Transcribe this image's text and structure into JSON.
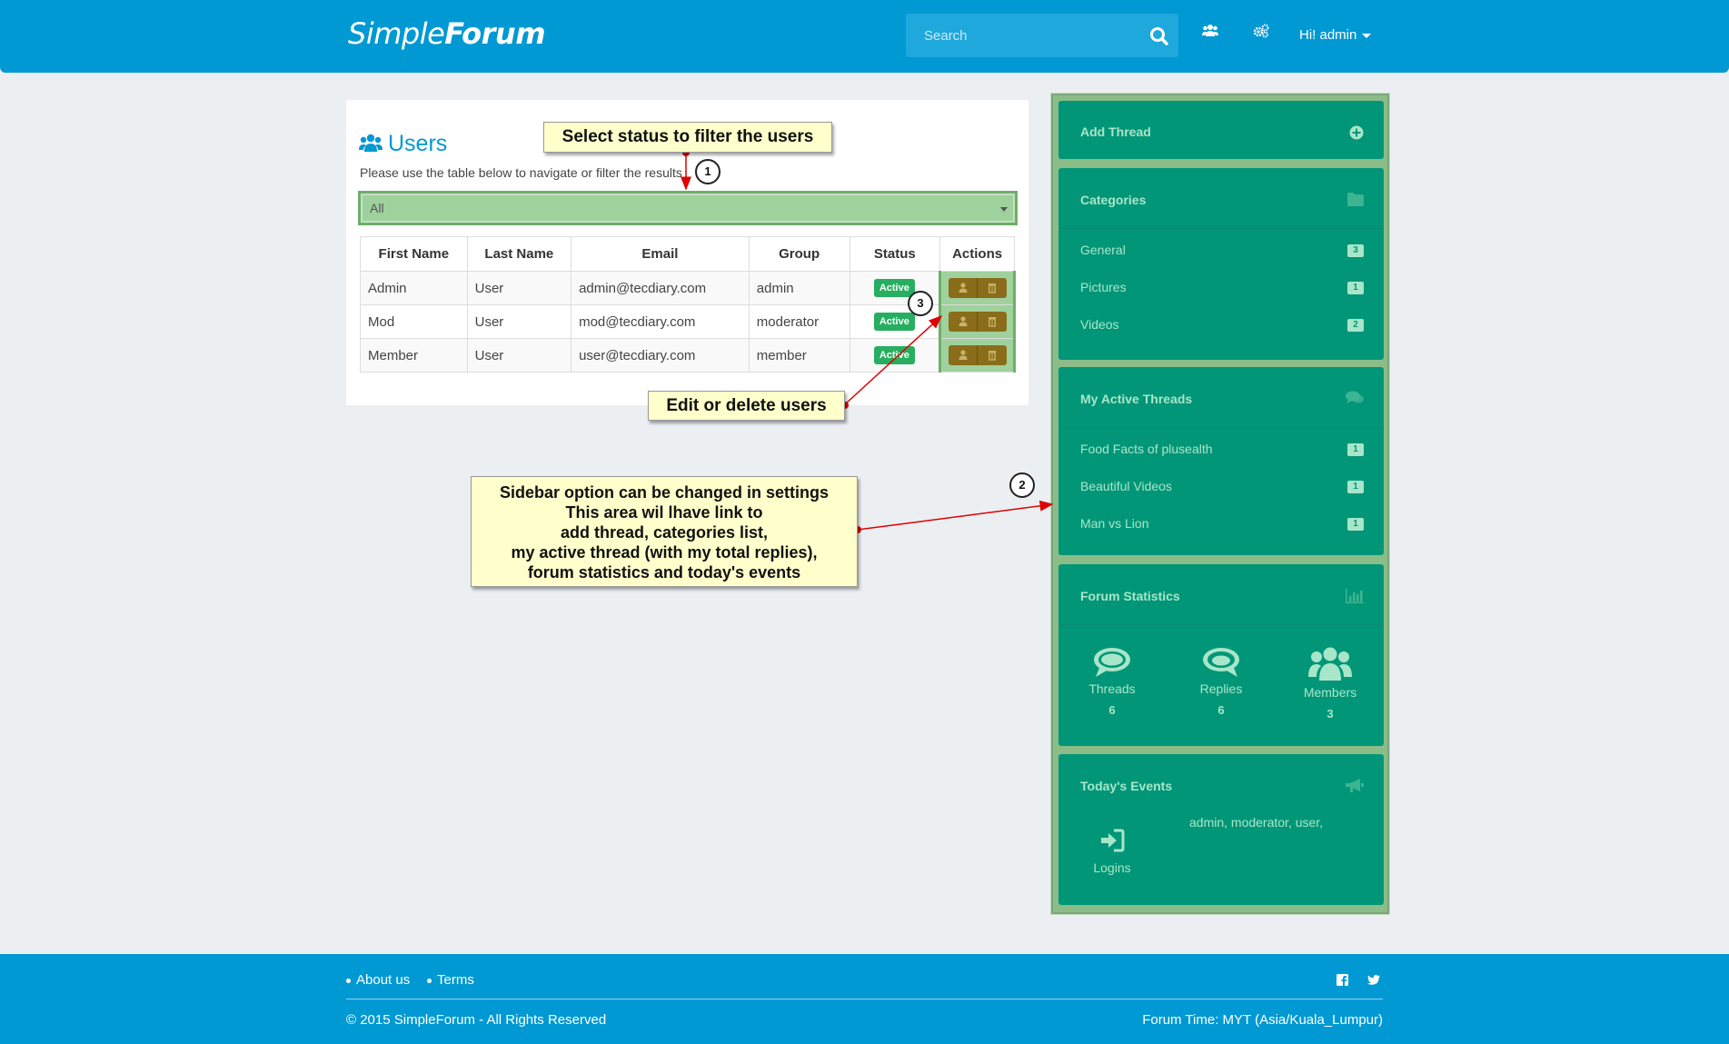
{
  "header": {
    "brand_light": "Simple",
    "brand_bold": "Forum",
    "search_placeholder": "Search",
    "user_greeting": "Hi! admin"
  },
  "main": {
    "title": "Users",
    "subtitle": "Please use the table below to navigate or filter the results",
    "status_filter": "All",
    "columns": [
      "First Name",
      "Last Name",
      "Email",
      "Group",
      "Status",
      "Actions"
    ],
    "rows": [
      {
        "first": "Admin",
        "last": "User",
        "email": "admin@tecdiary.com",
        "group": "admin",
        "status": "Active"
      },
      {
        "first": "Mod",
        "last": "User",
        "email": "mod@tecdiary.com",
        "group": "moderator",
        "status": "Active"
      },
      {
        "first": "Member",
        "last": "User",
        "email": "user@tecdiary.com",
        "group": "member",
        "status": "Active"
      }
    ]
  },
  "sidebar": {
    "add_thread": "Add Thread",
    "categories_title": "Categories",
    "categories": [
      {
        "label": "General",
        "count": "3"
      },
      {
        "label": "Pictures",
        "count": "1"
      },
      {
        "label": "Videos",
        "count": "2"
      }
    ],
    "threads_title": "My Active Threads",
    "threads": [
      {
        "label": "Food Facts of plusealth",
        "count": "1"
      },
      {
        "label": "Beautiful Videos",
        "count": "1"
      },
      {
        "label": "Man vs Lion",
        "count": "1"
      }
    ],
    "stats_title": "Forum Statistics",
    "stats": [
      {
        "label": "Threads",
        "value": "6"
      },
      {
        "label": "Replies",
        "value": "6"
      },
      {
        "label": "Members",
        "value": "3"
      }
    ],
    "events_title": "Today's Events",
    "events_logins_label": "Logins",
    "events_users": "admin, moderator, user,"
  },
  "callouts": {
    "filter": "Select status to filter the users",
    "edit": "Edit or delete users",
    "sidebar_lines": [
      "Sidebar option can be changed in settings",
      "This area wil lhave link to",
      "add thread, categories list,",
      "my active thread (with my total replies),",
      "forum statistics and today's events"
    ],
    "num1": "1",
    "num2": "2",
    "num3": "3"
  },
  "footer": {
    "about": "About us",
    "terms": "Terms",
    "copyright": "© 2015 SimpleForum - All Rights Reserved",
    "forum_time": "Forum Time: MYT (Asia/Kuala_Lumpur)"
  },
  "colors": {
    "header_blue": "#0099d3",
    "sidebar_teal": "#029678",
    "sidebar_text": "#a8e6c9",
    "active_badge": "#27ae60",
    "callout_bg": "#ffffcc",
    "annotation_red": "#e00000"
  }
}
